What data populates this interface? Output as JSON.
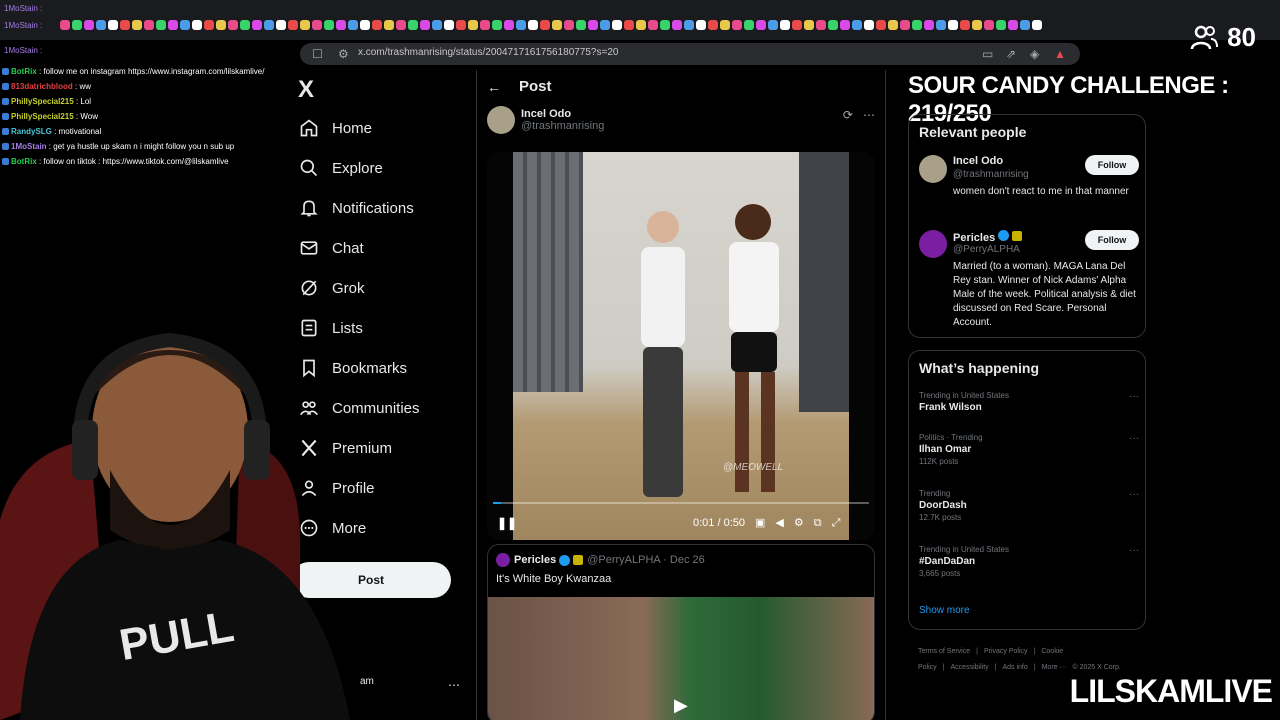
{
  "stream": {
    "viewer_count": "80",
    "challenge": "SOUR CANDY CHALLENGE : 219/250",
    "brand": "LILSKAMLIVE"
  },
  "browser": {
    "url": "x.com/trashmanrising/status/2004717161756180775?s=20"
  },
  "top_chat": [
    "1MoStain :",
    "1MoStain :",
    "1MoStain :"
  ],
  "chat": [
    {
      "user": "BotRix",
      "msg": ": follow me on instagram https://www.instagram.com/lilskamlive/",
      "color": "#1fd14f"
    },
    {
      "user": "813datrichblood",
      "msg": ": ww",
      "color": "#e43f3f"
    },
    {
      "user": "PhillySpecial215",
      "msg": ": Lol",
      "color": "#c7d12a"
    },
    {
      "user": "PhillySpecial215",
      "msg": ": Wow",
      "color": "#c7d12a"
    },
    {
      "user": "RandySLG",
      "msg": ": motivational",
      "color": "#49c7d8"
    },
    {
      "user": "1MoStain",
      "msg": ": get ya hustle up skam n i might follow you n sub up",
      "color": "#a57ce8"
    },
    {
      "user": "BotRix",
      "msg": ": follow on tiktok : https://www.tiktok.com/@lilskamlive",
      "color": "#1fd14f"
    }
  ],
  "nav": {
    "logo": "X",
    "items": [
      {
        "label": "Home",
        "icon": "home-icon"
      },
      {
        "label": "Explore",
        "icon": "search-icon"
      },
      {
        "label": "Notifications",
        "icon": "bell-icon"
      },
      {
        "label": "Chat",
        "icon": "mail-icon"
      },
      {
        "label": "Grok",
        "icon": "grok-icon"
      },
      {
        "label": "Lists",
        "icon": "list-icon"
      },
      {
        "label": "Bookmarks",
        "icon": "bookmark-icon"
      },
      {
        "label": "Communities",
        "icon": "people-icon"
      },
      {
        "label": "Premium",
        "icon": "x-icon"
      },
      {
        "label": "Profile",
        "icon": "person-icon"
      },
      {
        "label": "More",
        "icon": "more-circle-icon"
      }
    ],
    "post_button": "Post",
    "account_fragment": "am"
  },
  "post": {
    "header": "Post",
    "author_name": "Incel Odo",
    "author_handle": "@trashmanrising",
    "video": {
      "current_time": "0:01",
      "duration": "0:50",
      "time_display": "0:01 / 0:50",
      "progress": 0.02,
      "watermark": "@MEOWELL"
    },
    "quote": {
      "name": "Pericles",
      "handle_date": "@PerryALPHA · Dec 26",
      "text": "It's White Boy Kwanzaa"
    }
  },
  "relevant": {
    "title": "Relevant people",
    "people": [
      {
        "name": "Incel Odo",
        "handle": "@trashmanrising",
        "bio": "women don't react to me in that manner",
        "follow": "Follow"
      },
      {
        "name": "Pericles",
        "handle": "@PerryALPHA",
        "bio": "Married (to a woman). MAGA Lana Del Rey stan. Winner of Nick Adams' Alpha Male of the week. Political analysis & diet discussed on Red Scare. Personal Account.",
        "follow": "Follow"
      }
    ]
  },
  "happening": {
    "title": "What’s happening",
    "trends": [
      {
        "context": "Trending in United States",
        "topic": "Frank Wilson",
        "posts": ""
      },
      {
        "context": "Politics · Trending",
        "topic": "Ilhan Omar",
        "posts": "112K posts"
      },
      {
        "context": "Trending",
        "topic": "DoorDash",
        "posts": "12.7K posts"
      },
      {
        "context": "Trending in United States",
        "topic": "#DanDaDan",
        "posts": "3,665 posts"
      }
    ],
    "show_more": "Show more"
  },
  "footer": {
    "links": [
      "Terms of Service",
      "|",
      "Privacy Policy",
      "|",
      "Cookie Policy",
      "|",
      "Accessibility",
      "|",
      "Ads info",
      "|",
      "More ···",
      "© 2025 X Corp."
    ]
  },
  "colors": {
    "accent": "#1d9bf0",
    "background": "#000000",
    "border": "#2f3336"
  }
}
